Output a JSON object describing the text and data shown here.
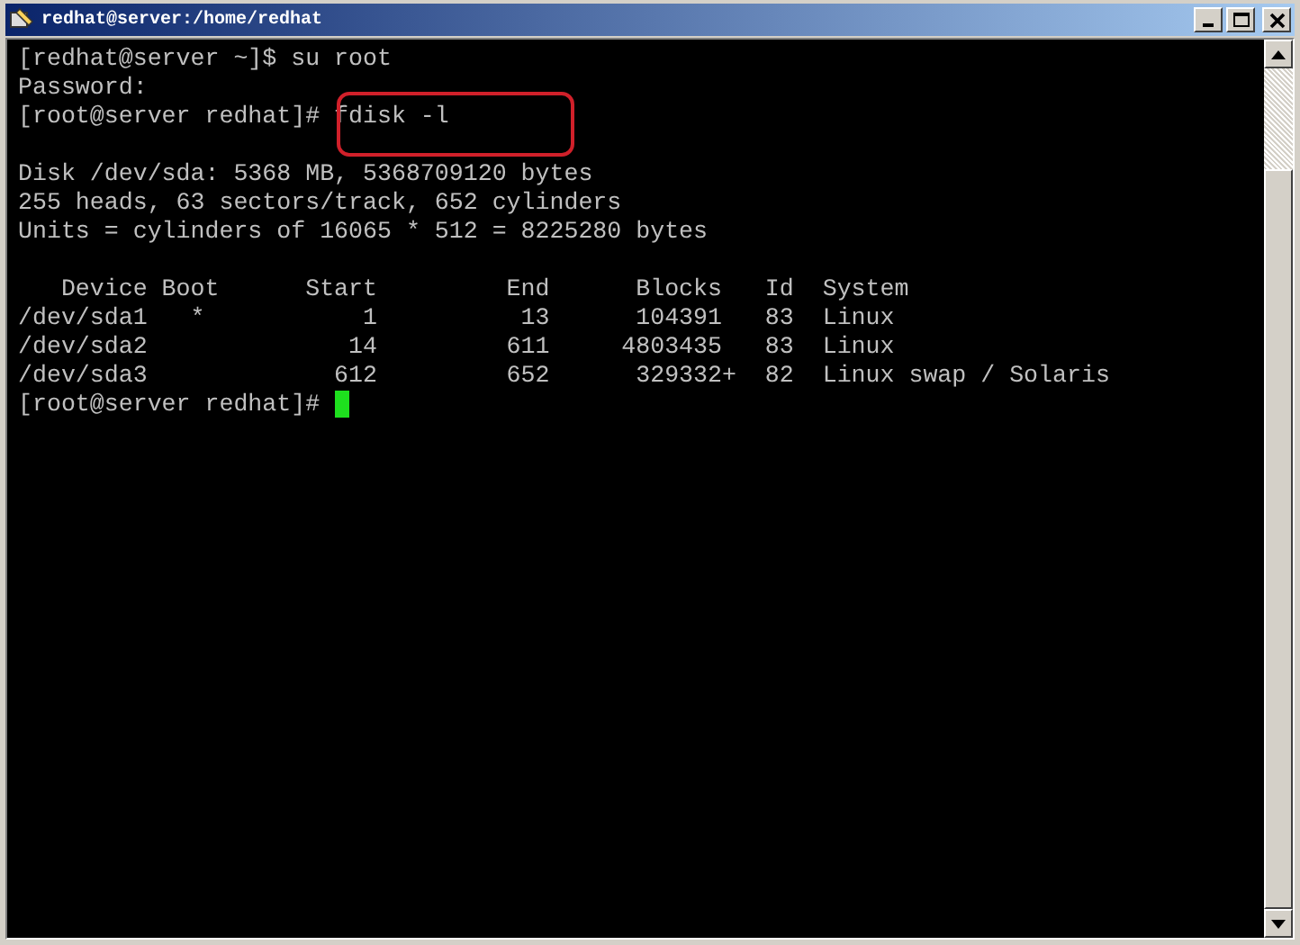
{
  "window": {
    "title": "redhat@server:/home/redhat"
  },
  "terminal": {
    "blocks": [
      [
        "[redhat@server ~]$ su root",
        "Password:",
        "[root@server redhat]# fdisk -l"
      ],
      [
        "Disk /dev/sda: 5368 MB, 5368709120 bytes",
        "255 heads, 63 sectors/track, 652 cylinders",
        "Units = cylinders of 16065 * 512 = 8225280 bytes"
      ],
      [
        "   Device Boot      Start         End      Blocks   Id  System",
        "/dev/sda1   *           1          13      104391   83  Linux",
        "/dev/sda2              14         611     4803435   83  Linux",
        "/dev/sda3             612         652      329332+  82  Linux swap / Solaris",
        "[root@server redhat]# "
      ]
    ],
    "cursor_visible": true
  }
}
